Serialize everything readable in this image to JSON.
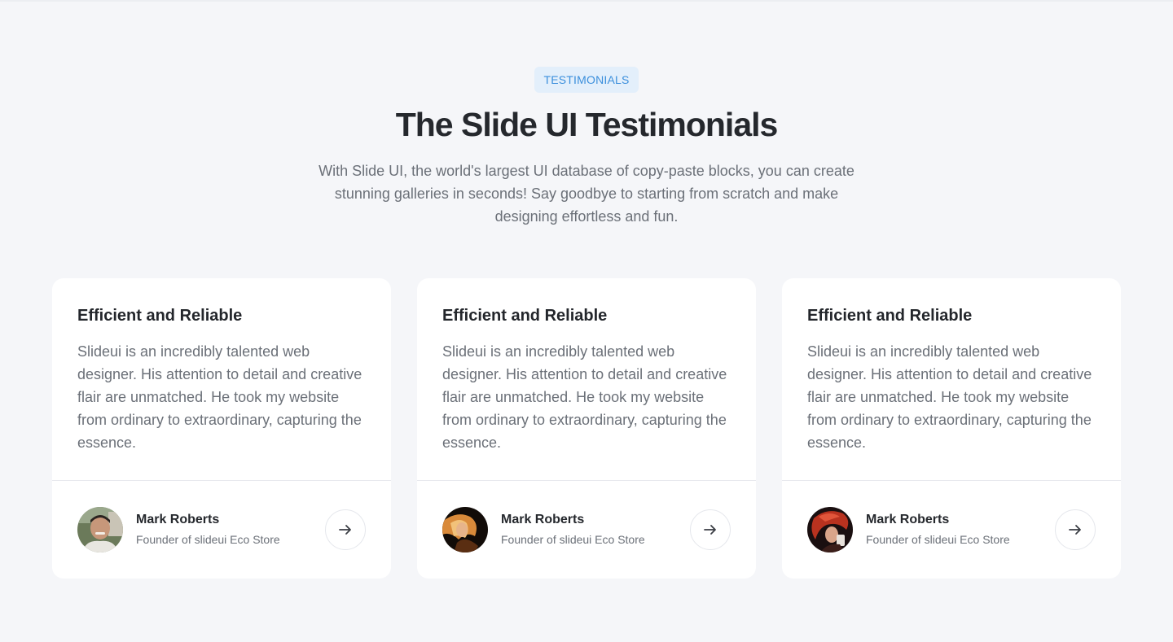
{
  "header": {
    "badge": "TESTIMONIALS",
    "title": "The Slide UI Testimonials",
    "subtitle": "With Slide UI, the world's largest UI database of copy-paste blocks, you can create stunning galleries in seconds! Say goodbye to starting from scratch and make designing effortless and fun."
  },
  "testimonials": [
    {
      "title": "Efficient and Reliable",
      "text": "Slideui is an incredibly talented web designer. His attention to detail and creative flair are unmatched. He took my website from ordinary to extraordinary, capturing the essence.",
      "name": "Mark Roberts",
      "role": "Founder of slideui Eco Store",
      "avatar_icon": "avatar-photo-smiling-man"
    },
    {
      "title": "Efficient and Reliable",
      "text": "Slideui is an incredibly talented web designer. His attention to detail and creative flair are unmatched. He took my website from ordinary to extraordinary, capturing the essence.",
      "name": "Mark Roberts",
      "role": "Founder of slideui Eco Store",
      "avatar_icon": "avatar-photo-woman-fire"
    },
    {
      "title": "Efficient and Reliable",
      "text": "Slideui is an incredibly talented web designer. His attention to detail and creative flair are unmatched. He took my website from ordinary to extraordinary, capturing the essence.",
      "name": "Mark Roberts",
      "role": "Founder of slideui Eco Store",
      "avatar_icon": "avatar-photo-red-hair"
    }
  ],
  "colors": {
    "background": "#f5f6f9",
    "badge_bg": "#e3effb",
    "badge_text": "#3b8fdc",
    "heading": "#25282d",
    "body_text": "#6b7078",
    "card_bg": "#ffffff"
  },
  "icons": {
    "next": "arrow-right-icon"
  }
}
